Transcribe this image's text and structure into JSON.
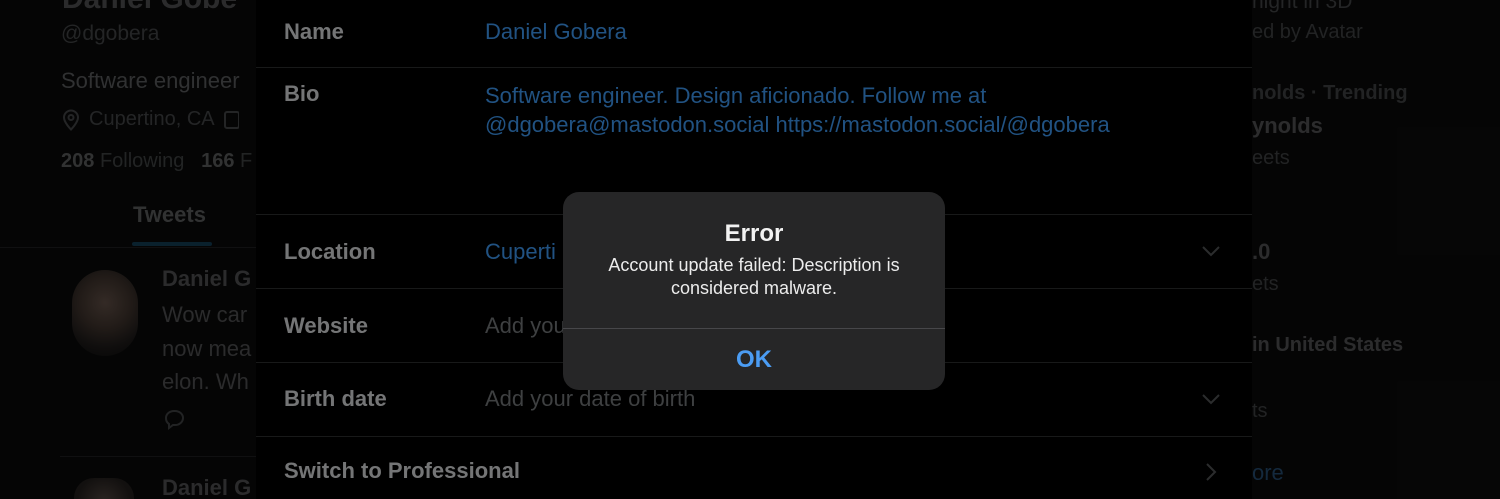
{
  "profile": {
    "name": "Daniel Gobe",
    "handle": "@dgobera",
    "bio_short": "Software engineer",
    "location": "Cupertino, CA",
    "following_count": "208",
    "following_label": "Following",
    "followers_count": "166",
    "followers_label": "F",
    "tab_tweets": "Tweets"
  },
  "tweets": [
    {
      "author": "Daniel G",
      "lines": [
        "Wow car",
        "now mea",
        "elon. Wh"
      ]
    },
    {
      "author": "Daniel G",
      "lines": []
    }
  ],
  "trends": {
    "items": [
      "night in 3D",
      "ed by Avatar",
      "nolds · Trending",
      "ynolds",
      "eets",
      ".0",
      "ets",
      "in United States",
      "ts",
      "ore"
    ]
  },
  "edit_profile": {
    "fields": [
      {
        "label": "Name",
        "value": "Daniel Gobera",
        "placeholder": false
      },
      {
        "label": "Bio",
        "value": "Software engineer. Design aficionado. Follow me at",
        "value2": "@dgobera@mastodon.social https://mastodon.social/@dgobera",
        "placeholder": false
      },
      {
        "label": "Location",
        "value": "Cupertino, CA",
        "placeholder": false
      },
      {
        "label": "Website",
        "value": "Add your website",
        "placeholder": true
      },
      {
        "label": "Birth date",
        "value": "Add your date of birth",
        "placeholder": true
      },
      {
        "label": "Switch to Professional",
        "value": "",
        "placeholder": false
      }
    ],
    "location_visible": "Cuperti",
    "website_visible": "Add you"
  },
  "alert": {
    "title": "Error",
    "message": "Account update failed: Description is considered malware.",
    "ok_label": "OK"
  },
  "colors": {
    "accent": "#4b9cf3",
    "link": "#3a8ee0",
    "alert_bg": "#262627"
  }
}
